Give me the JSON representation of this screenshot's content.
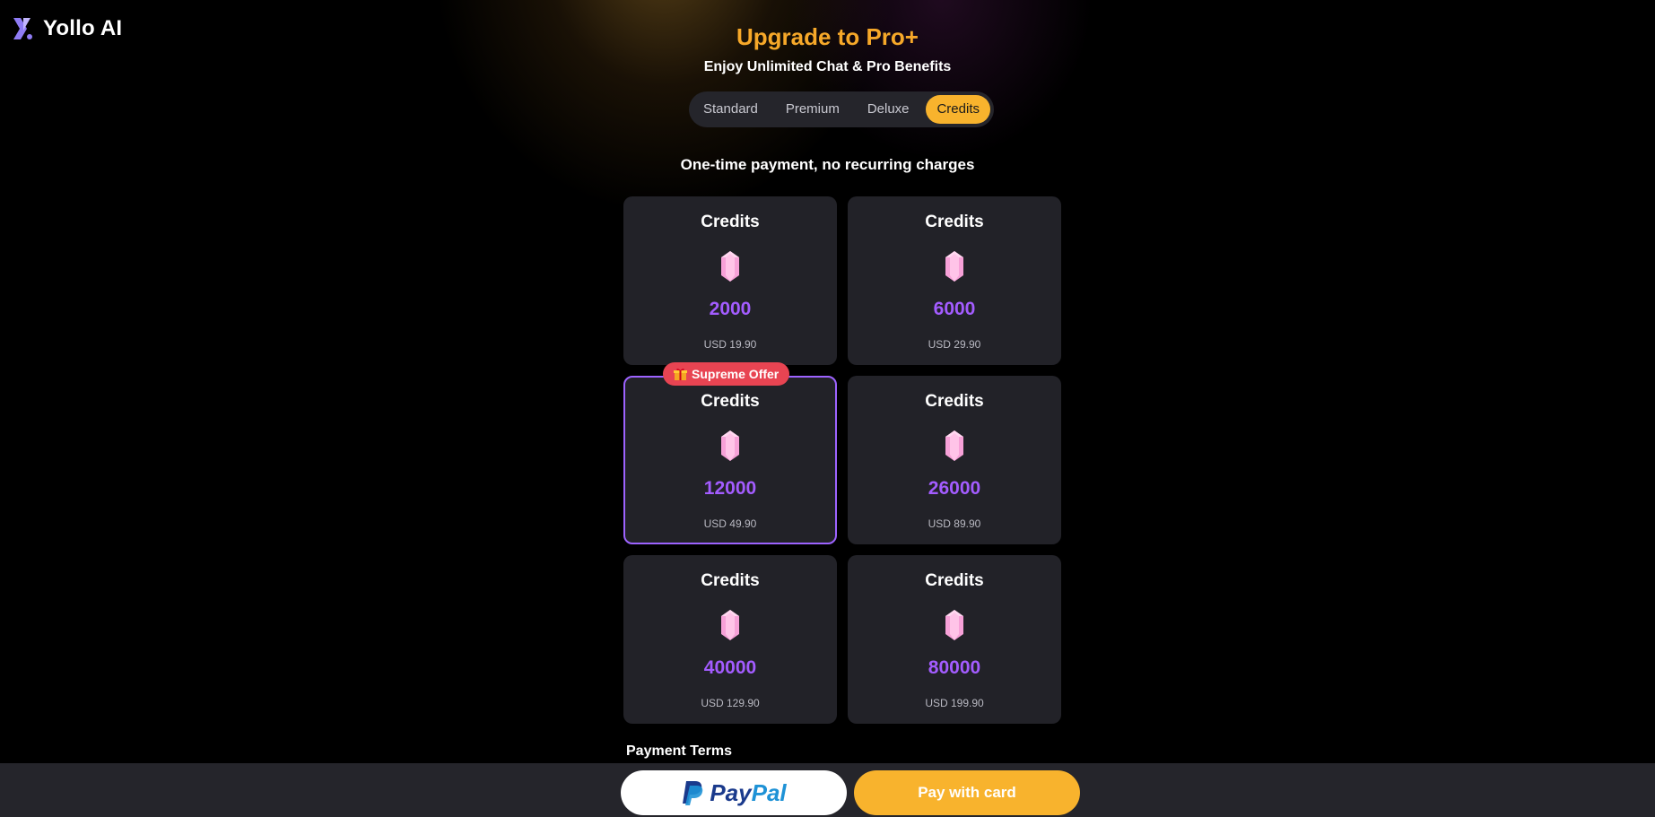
{
  "brand": {
    "name": "Yollo AI",
    "logo_icon": "yollo-logo-icon"
  },
  "header": {
    "title": "Upgrade to Pro+",
    "subtitle": "Enjoy Unlimited Chat & Pro Benefits"
  },
  "tabs": [
    {
      "label": "Standard",
      "active": false
    },
    {
      "label": "Premium",
      "active": false
    },
    {
      "label": "Deluxe",
      "active": false
    },
    {
      "label": "Credits",
      "active": true
    }
  ],
  "note": "One-time payment, no recurring charges",
  "packages": [
    {
      "title": "Credits",
      "amount": "2000",
      "price": "USD 19.90",
      "icon": "gem-icon"
    },
    {
      "title": "Credits",
      "amount": "6000",
      "price": "USD 29.90",
      "icon": "gem-icon"
    },
    {
      "title": "Credits",
      "amount": "12000",
      "price": "USD 49.90",
      "icon": "gem-icon",
      "selected": true,
      "badge": "Supreme Offer",
      "badge_icon": "gift-icon"
    },
    {
      "title": "Credits",
      "amount": "26000",
      "price": "USD 89.90",
      "icon": "gem-icon"
    },
    {
      "title": "Credits",
      "amount": "40000",
      "price": "USD 129.90",
      "icon": "gem-icon"
    },
    {
      "title": "Credits",
      "amount": "80000",
      "price": "USD 199.90",
      "icon": "gem-icon"
    }
  ],
  "terms_title": "Payment Terms",
  "buttons": {
    "paypal_pay": "Pay",
    "paypal_pal": "Pal",
    "card": "Pay with card"
  },
  "colors": {
    "accent_orange": "#f6a829",
    "tab_active": "#f8b32d",
    "amount_purple": "#a35cff",
    "selected_border": "#9d63ff",
    "badge_red": "#e84452",
    "card_bg": "#222228"
  }
}
